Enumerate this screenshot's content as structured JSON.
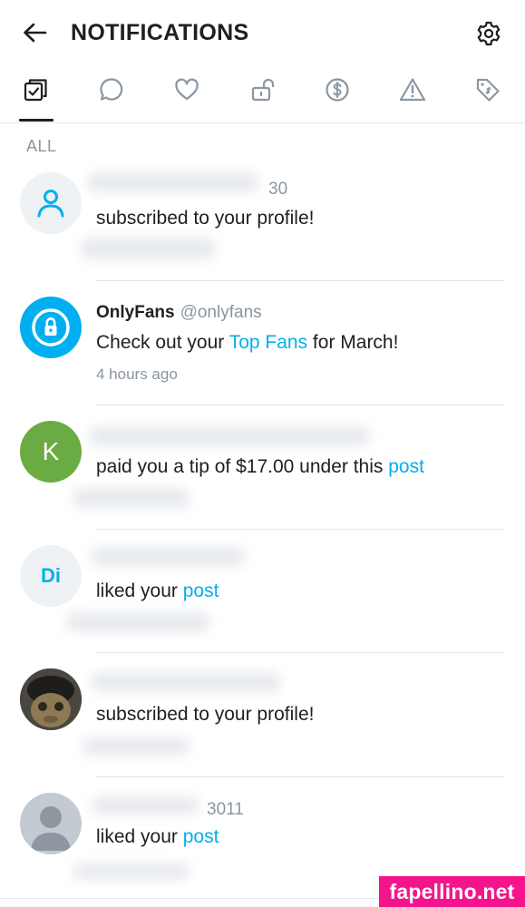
{
  "header": {
    "title": "NOTIFICATIONS",
    "back_icon": "arrow-left-icon",
    "settings_icon": "gear-icon"
  },
  "tabs": [
    {
      "name": "all",
      "icon": "checklist-icon",
      "active": true
    },
    {
      "name": "comments",
      "icon": "speech-bubble-icon",
      "active": false
    },
    {
      "name": "likes",
      "icon": "heart-icon",
      "active": false
    },
    {
      "name": "subscriptions",
      "icon": "unlock-icon",
      "active": false
    },
    {
      "name": "tips",
      "icon": "dollar-circle-icon",
      "active": false
    },
    {
      "name": "warnings",
      "icon": "warning-triangle-icon",
      "active": false
    },
    {
      "name": "promotions",
      "icon": "price-tag-icon",
      "active": false
    }
  ],
  "section_label": "ALL",
  "notifications": [
    {
      "avatar": {
        "kind": "icon",
        "icon": "user-outline-icon",
        "bg": "#eef2f5",
        "fg": "#00aff0"
      },
      "name_visible": "30",
      "text": "subscribed to your profile!"
    },
    {
      "avatar": {
        "kind": "icon",
        "icon": "onlyfans-lock-icon",
        "bg": "#00aff0",
        "fg": "#ffffff"
      },
      "name": "OnlyFans",
      "handle": "@onlyfans",
      "text_before": "Check out your ",
      "text_link": "Top Fans",
      "text_after": " for March!",
      "time": "4 hours ago"
    },
    {
      "avatar": {
        "kind": "initials",
        "initials": "K",
        "bg": "#6aac43",
        "fg": "#ffffff"
      },
      "text_before": "paid you a tip of $17.00 under this ",
      "text_link": "post"
    },
    {
      "avatar": {
        "kind": "initials",
        "initials": "Di",
        "bg": "#eef2f5",
        "fg": "#00aff0"
      },
      "text_before": "liked your ",
      "text_link": "post"
    },
    {
      "avatar": {
        "kind": "photo",
        "icon": "profile-photo-icon"
      },
      "text": "subscribed to your profile!"
    },
    {
      "avatar": {
        "kind": "icon",
        "icon": "default-user-silhouette-icon",
        "bg": "#c3cad2",
        "fg": "#8e979f"
      },
      "name_visible": "3011",
      "text_before": "liked your ",
      "text_link": "post"
    }
  ],
  "colors": {
    "accent": "#00aff0",
    "muted": "#8a96a3",
    "divider": "#e3e6ea",
    "watermark_bg": "#f5148c"
  },
  "watermark": "fapellino.net"
}
